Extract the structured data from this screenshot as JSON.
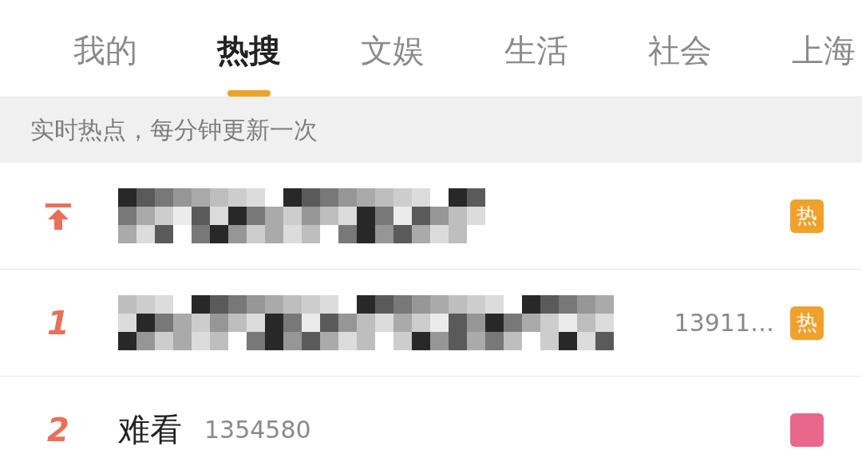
{
  "tabs": [
    {
      "label": "我的",
      "selected": false
    },
    {
      "label": "热搜",
      "selected": true
    },
    {
      "label": "文娱",
      "selected": false
    },
    {
      "label": "生活",
      "selected": false
    },
    {
      "label": "社会",
      "selected": false
    },
    {
      "label": "上海",
      "selected": false
    }
  ],
  "notice": "实时热点，每分钟更新一次",
  "rows": [
    {
      "kind": "pinned",
      "title_hidden": true,
      "badge": {
        "label": "热",
        "color": "#f0a12c"
      }
    },
    {
      "kind": "ranked",
      "rank": "1",
      "title_hidden": true,
      "count": "13911…",
      "badge": {
        "label": "热",
        "color": "#f0a12c"
      }
    },
    {
      "kind": "ranked",
      "rank": "2",
      "title_hidden": false,
      "title": "难看",
      "count": "1354580",
      "badge": {
        "color": "#e9678b"
      }
    }
  ]
}
